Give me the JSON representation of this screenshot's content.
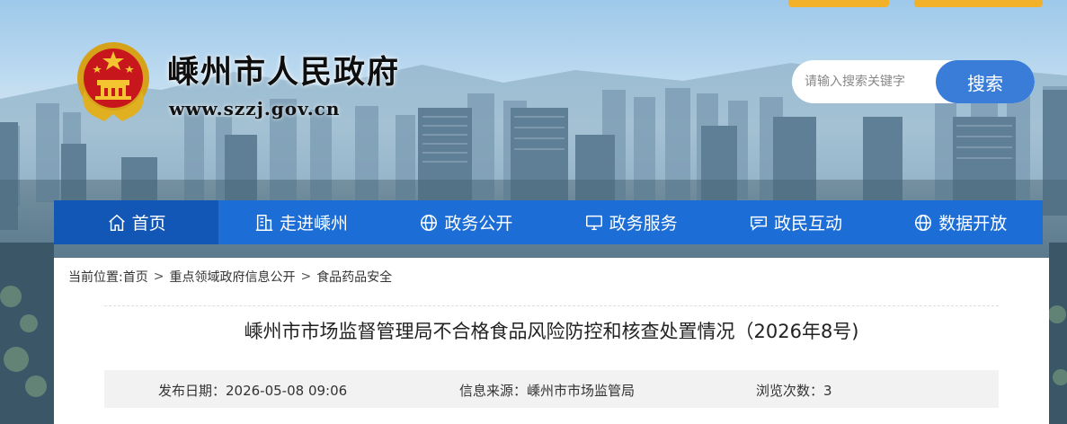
{
  "site": {
    "title": "嵊州市人民政府",
    "url": "www.szzj.gov.cn"
  },
  "search": {
    "placeholder": "请输入搜索关键字",
    "button_label": "搜索"
  },
  "nav": {
    "items": [
      {
        "label": "首页",
        "icon": "home-icon"
      },
      {
        "label": "走进嵊州",
        "icon": "building-icon"
      },
      {
        "label": "政务公开",
        "icon": "globe-icon"
      },
      {
        "label": "政务服务",
        "icon": "monitor-icon"
      },
      {
        "label": "政民互动",
        "icon": "chat-icon"
      },
      {
        "label": "数据开放",
        "icon": "globe-icon"
      }
    ],
    "active_index": 0
  },
  "breadcrumb": {
    "prefix": "当前位置:",
    "items": [
      "首页",
      "重点领域政府信息公开",
      "食品药品安全"
    ],
    "separator": ">"
  },
  "article": {
    "title": "嵊州市市场监督管理局不合格食品风险防控和核查处置情况（2026年8号)",
    "date_label": "发布日期：2026-05-08 09:06",
    "source_label": "信息来源：嵊州市市场监管局",
    "views_label": "浏览次数：3"
  },
  "colors": {
    "nav_blue": "#1c6ed6",
    "nav_active": "#1357b6",
    "search_button": "#3a7dd8",
    "top_tabs": "#f3b12a"
  }
}
